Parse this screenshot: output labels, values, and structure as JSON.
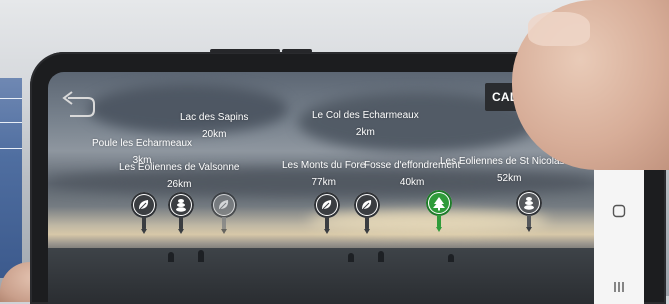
{
  "screen": {
    "calibration_label": "CALIBRATION",
    "back_icon": "back-arrow-icon"
  },
  "pois": [
    {
      "name": "Poule les Echarmeaux",
      "distance": "3km"
    },
    {
      "name": "Lac des Sapins",
      "distance": "20km"
    },
    {
      "name": "Les Eoliennes de Valsonne",
      "distance": "26km"
    },
    {
      "name": "Le Col des Echarmeaux",
      "distance": "2km"
    },
    {
      "name": "Les Monts du Fore",
      "distance": "77km"
    },
    {
      "name": "Fosse d'effondrement",
      "distance": "40km"
    },
    {
      "name": "Les Eoliennes de St Nicolas de",
      "distance": "52km"
    }
  ],
  "markers": [
    {
      "icon": "leaf-icon",
      "color": "#3a3d41"
    },
    {
      "icon": "stones-icon",
      "color": "#3a3d41"
    },
    {
      "icon": "leaf-icon",
      "color": "#3a3d41"
    },
    {
      "icon": "leaf-icon",
      "color": "#3a3d41"
    },
    {
      "icon": "leaf-icon",
      "color": "#3a3d41"
    },
    {
      "icon": "tree-icon",
      "color": "#2f9b3a"
    },
    {
      "icon": "stones-icon",
      "color": "#3a3d41"
    }
  ],
  "navbar": {
    "back_icon": "nav-back-chevron-icon",
    "home_icon": "nav-home-icon",
    "recents_icon": "nav-recents-icon"
  },
  "colors": {
    "accent_green": "#2f9b3a",
    "marker_dark": "#3a3d41",
    "calibration_bg": "#2a2c2f"
  }
}
